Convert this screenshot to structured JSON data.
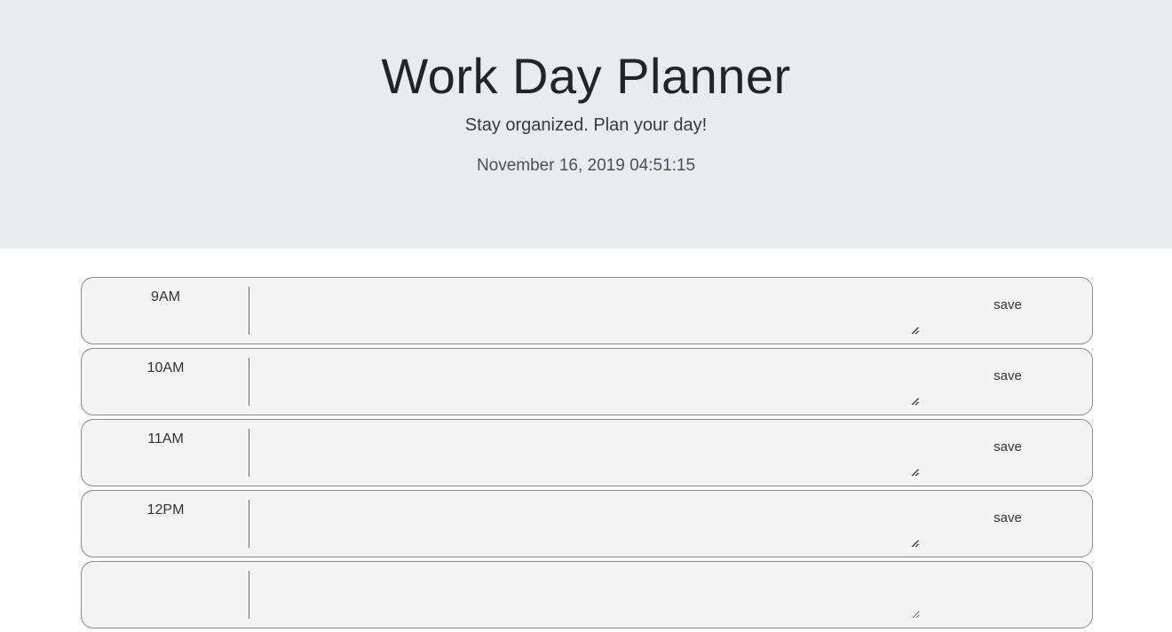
{
  "header": {
    "title": "Work Day Planner",
    "subtitle": "Stay organized. Plan your day!",
    "datetime": "November 16, 2019 04:51:15"
  },
  "planner": {
    "rows": [
      {
        "hour": "9AM",
        "task": "",
        "save_label": "save"
      },
      {
        "hour": "10AM",
        "task": "",
        "save_label": "save"
      },
      {
        "hour": "11AM",
        "task": "",
        "save_label": "save"
      },
      {
        "hour": "12PM",
        "task": "",
        "save_label": "save"
      },
      {
        "hour": "",
        "task": "",
        "save_label": ""
      }
    ]
  },
  "colors": {
    "header_bg": "#e9ecef",
    "row_bg": "#f3f3f3",
    "row_border": "#8a8a8a"
  }
}
